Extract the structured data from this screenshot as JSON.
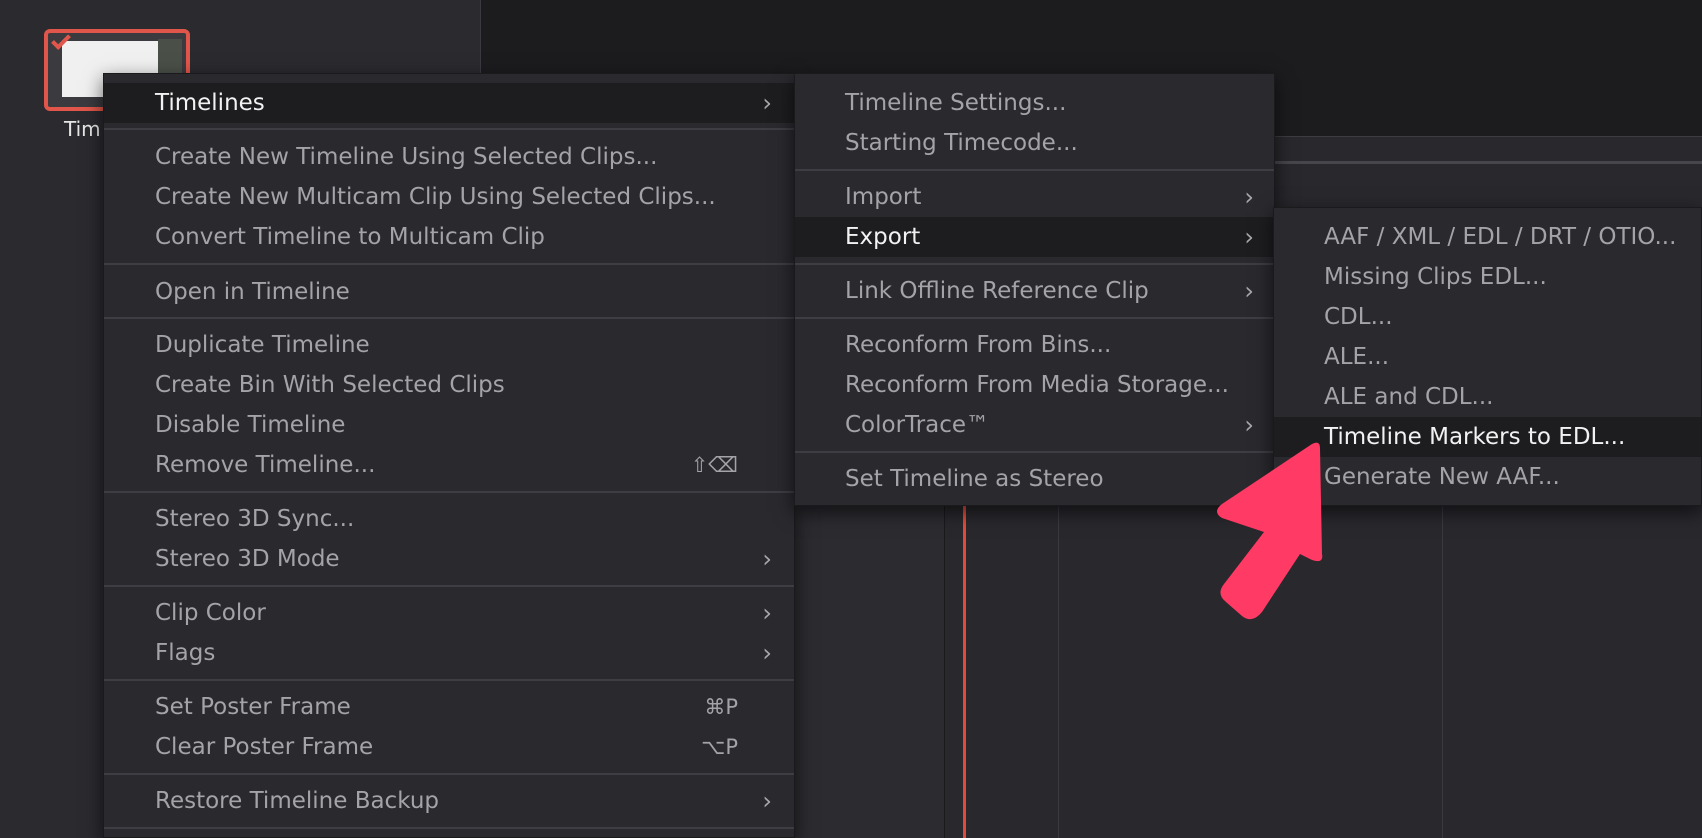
{
  "bin": {
    "thumbnail_label": "Tim"
  },
  "context_menu": {
    "items": [
      {
        "label": "Timelines",
        "submenu": true,
        "highlighted": true
      },
      {
        "label": "Create New Timeline Using Selected Clips..."
      },
      {
        "label": "Create New Multicam Clip Using Selected Clips..."
      },
      {
        "label": "Convert Timeline to Multicam Clip"
      },
      {
        "label": "Open in Timeline"
      },
      {
        "label": "Duplicate Timeline"
      },
      {
        "label": "Create Bin With Selected Clips"
      },
      {
        "label": "Disable Timeline"
      },
      {
        "label": "Remove Timeline...",
        "shortcut": "⇧⌫"
      },
      {
        "label": "Stereo 3D Sync..."
      },
      {
        "label": "Stereo 3D Mode",
        "submenu": true
      },
      {
        "label": "Clip Color",
        "submenu": true
      },
      {
        "label": "Flags",
        "submenu": true
      },
      {
        "label": "Set Poster Frame",
        "shortcut": "⌘P"
      },
      {
        "label": "Clear Poster Frame",
        "shortcut": "⌥P"
      },
      {
        "label": "Restore Timeline Backup",
        "submenu": true
      }
    ]
  },
  "timelines_submenu": {
    "items": [
      {
        "label": "Timeline Settings..."
      },
      {
        "label": "Starting Timecode..."
      },
      {
        "label": "Import",
        "submenu": true
      },
      {
        "label": "Export",
        "submenu": true,
        "highlighted": true
      },
      {
        "label": "Link Offline Reference Clip",
        "submenu": true
      },
      {
        "label": "Reconform From Bins..."
      },
      {
        "label": "Reconform From Media Storage..."
      },
      {
        "label": "ColorTrace™",
        "submenu": true
      },
      {
        "label": "Set Timeline as Stereo"
      }
    ]
  },
  "export_submenu": {
    "items": [
      {
        "label": "AAF / XML / EDL / DRT / OTIO..."
      },
      {
        "label": "Missing Clips EDL..."
      },
      {
        "label": "CDL..."
      },
      {
        "label": "ALE..."
      },
      {
        "label": "ALE and CDL..."
      },
      {
        "label": "Timeline Markers to EDL...",
        "highlighted": true
      },
      {
        "label": "Generate New AAF..."
      }
    ]
  },
  "chevron_glyph": "›",
  "annotation_arrow_color": "#ff3a64",
  "accent_color": "#e1564a"
}
